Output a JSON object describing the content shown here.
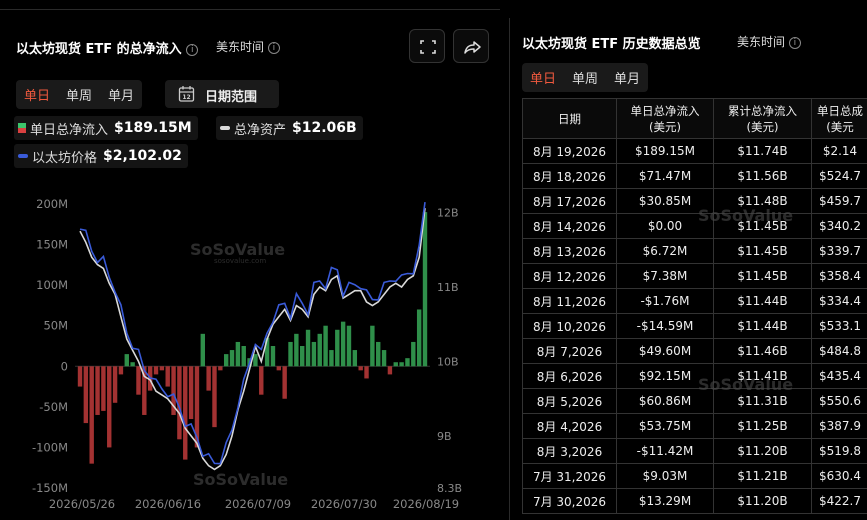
{
  "left": {
    "title": "以太坊现货 ETF 的总净流入",
    "timezone": "美东时间",
    "tabs": [
      "单日",
      "单周",
      "单月"
    ],
    "date_range_label": "日期范围",
    "legend": [
      {
        "label": "单日总净流入",
        "value": "$189.15M",
        "color_up": "#3cc46b",
        "color_down": "#d94040"
      },
      {
        "label": "总净资产",
        "value": "$12.06B",
        "color": "#d9d9d9"
      },
      {
        "label": "以太坊价格",
        "value": "$2,102.02",
        "color": "#3a5bd9"
      }
    ],
    "watermark": "SoSoValue",
    "watermark_sub": "sosovalue.com"
  },
  "right": {
    "title": "以太坊现货 ETF 历史数据总览",
    "timezone": "美东时间",
    "tabs": [
      "单日",
      "单周",
      "单月"
    ],
    "columns": [
      "日期",
      "单日总净流入\n(美元)",
      "累计总净流入\n(美元)",
      "单日总成\n(美元"
    ],
    "rows": [
      [
        "8月 19,2026",
        "$189.15M",
        "$11.74B",
        "$2.14"
      ],
      [
        "8月 18,2026",
        "$71.47M",
        "$11.56B",
        "$524.7"
      ],
      [
        "8月 17,2026",
        "$30.85M",
        "$11.48B",
        "$459.7"
      ],
      [
        "8月 14,2026",
        "$0.00",
        "$11.45B",
        "$340.2"
      ],
      [
        "8月 13,2026",
        "$6.72M",
        "$11.45B",
        "$339.7"
      ],
      [
        "8月 12,2026",
        "$7.38M",
        "$11.45B",
        "$358.4"
      ],
      [
        "8月 11,2026",
        "-$1.76M",
        "$11.44B",
        "$334.4"
      ],
      [
        "8月 10,2026",
        "-$14.59M",
        "$11.44B",
        "$533.1"
      ],
      [
        "8月 7,2026",
        "$49.60M",
        "$11.46B",
        "$484.8"
      ],
      [
        "8月 6,2026",
        "$92.15M",
        "$11.41B",
        "$435.4"
      ],
      [
        "8月 5,2026",
        "$60.86M",
        "$11.31B",
        "$550.6"
      ],
      [
        "8月 4,2026",
        "$53.75M",
        "$11.25B",
        "$387.9"
      ],
      [
        "8月 3,2026",
        "-$11.42M",
        "$11.20B",
        "$519.8"
      ],
      [
        "7月 31,2026",
        "$9.03M",
        "$11.21B",
        "$630.4"
      ],
      [
        "7月 30,2026",
        "$13.29M",
        "$11.20B",
        "$422.7"
      ]
    ]
  },
  "chart_data": {
    "type": "bar",
    "title": "",
    "x_tick_labels": [
      "2026/05/26",
      "2026/06/16",
      "2026/07/09",
      "2026/07/30",
      "2026/08/19"
    ],
    "y_left_ticks": [
      "200M",
      "150M",
      "100M",
      "50M",
      "0",
      "-50M",
      "-100M",
      "-150M"
    ],
    "y_left_range": [
      -150,
      200
    ],
    "y_right_ticks": [
      "12B",
      "11B",
      "10B",
      "9B",
      "8.3B"
    ],
    "series": [
      {
        "name": "单日总净流入",
        "type": "bar",
        "unit": "M USD",
        "values": [
          -25,
          -70,
          -120,
          -60,
          -55,
          -100,
          -45,
          -10,
          15,
          5,
          -35,
          -60,
          -30,
          -10,
          -5,
          -25,
          -60,
          -90,
          -115,
          -65,
          -100,
          40,
          -30,
          -75,
          -5,
          15,
          20,
          30,
          25,
          10,
          15,
          -35,
          35,
          25,
          -5,
          -40,
          30,
          40,
          25,
          45,
          30,
          40,
          50,
          20,
          45,
          55,
          50,
          20,
          -5,
          -15,
          50,
          30,
          20,
          -10,
          5,
          5,
          10,
          30,
          70,
          190
        ]
      },
      {
        "name": "总净资产",
        "type": "line",
        "unit": "B USD",
        "values": [
          11.75,
          11.6,
          11.4,
          11.3,
          11.25,
          11.05,
          10.9,
          10.6,
          10.3,
          10.15,
          10.0,
          9.8,
          9.75,
          9.6,
          9.55,
          9.5,
          9.4,
          9.3,
          9.1,
          9.0,
          8.9,
          8.7,
          8.6,
          8.55,
          8.6,
          8.75,
          9.0,
          9.35,
          9.6,
          9.9,
          10.2,
          10.0,
          10.3,
          10.5,
          10.6,
          10.7,
          10.55,
          10.75,
          10.7,
          10.6,
          10.9,
          11.0,
          10.95,
          11.1,
          11.15,
          10.85,
          10.9,
          10.95,
          10.95,
          10.8,
          10.75,
          10.8,
          10.9,
          11.0,
          11.05,
          11.0,
          11.1,
          11.15,
          11.4,
          12.06
        ]
      },
      {
        "name": "以太坊价格",
        "type": "line",
        "unit": "USD"
      }
    ]
  }
}
